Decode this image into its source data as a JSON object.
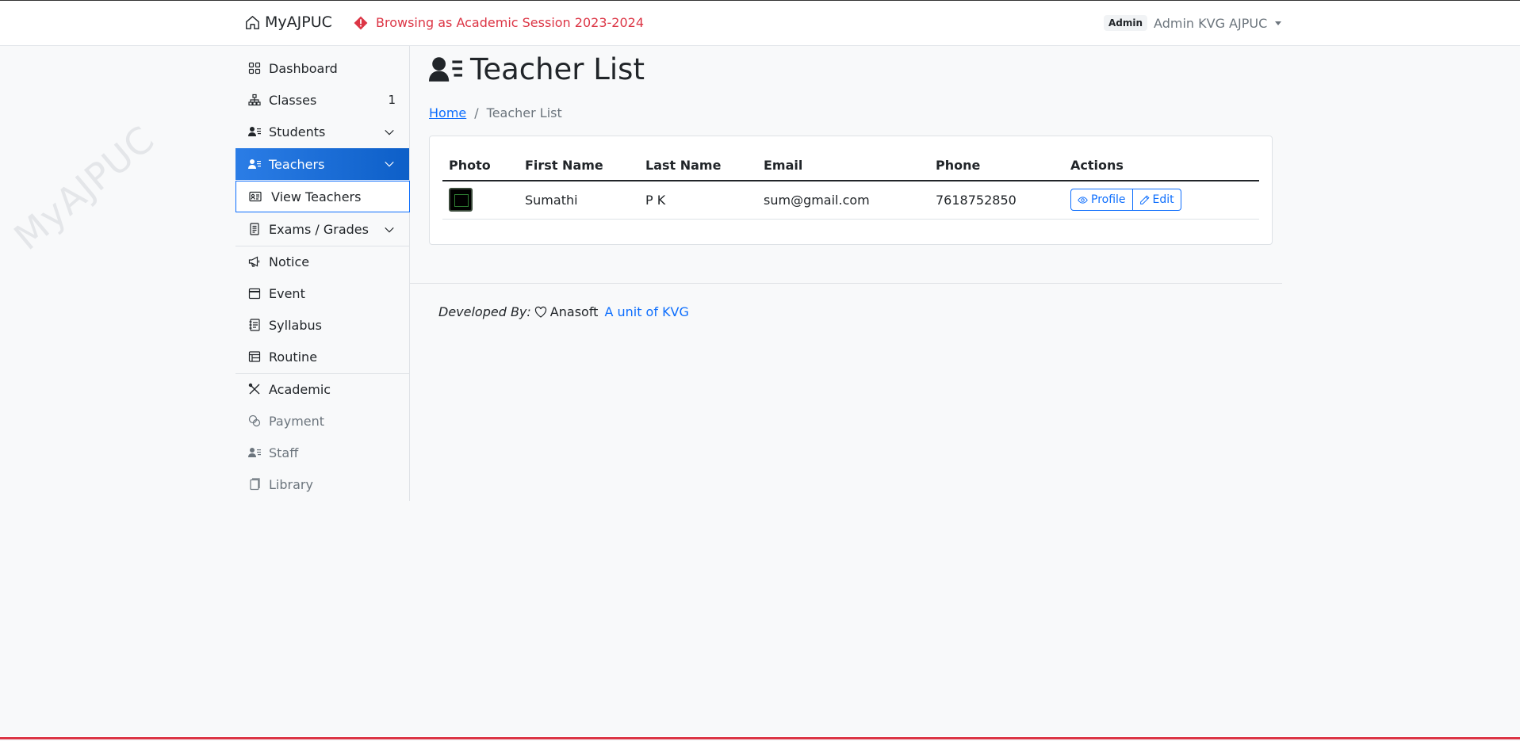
{
  "header": {
    "brand": "MyAJPUC",
    "session_notice": "Browsing as Academic Session 2023-2024",
    "role_badge": "Admin",
    "user_name": "Admin KVG AJPUC"
  },
  "watermark": "MyAJPUC",
  "sidebar": {
    "items": [
      {
        "label": "Dashboard"
      },
      {
        "label": "Classes",
        "count": "1"
      },
      {
        "label": "Students"
      },
      {
        "label": "Teachers"
      },
      {
        "label": "View Teachers"
      },
      {
        "label": "Exams / Grades"
      },
      {
        "label": "Notice"
      },
      {
        "label": "Event"
      },
      {
        "label": "Syllabus"
      },
      {
        "label": "Routine"
      },
      {
        "label": "Academic"
      },
      {
        "label": "Payment"
      },
      {
        "label": "Staff"
      },
      {
        "label": "Library"
      }
    ]
  },
  "page": {
    "title": "Teacher List",
    "breadcrumb": {
      "home": "Home",
      "separator": "/",
      "current": "Teacher List"
    }
  },
  "table": {
    "headers": [
      "Photo",
      "First Name",
      "Last Name",
      "Email",
      "Phone",
      "Actions"
    ],
    "rows": [
      {
        "first_name": "Sumathi",
        "last_name": "P K",
        "email": "sum@gmail.com",
        "phone": "7618752850",
        "profile_label": "Profile",
        "edit_label": "Edit"
      }
    ]
  },
  "footer": {
    "developed_by": "Developed By:",
    "company": "Anasoft",
    "unit_link": "A unit of KVG"
  },
  "colors": {
    "accent": "#0d6efd",
    "danger": "#dc3545",
    "active_nav": "#1a6fd8"
  }
}
